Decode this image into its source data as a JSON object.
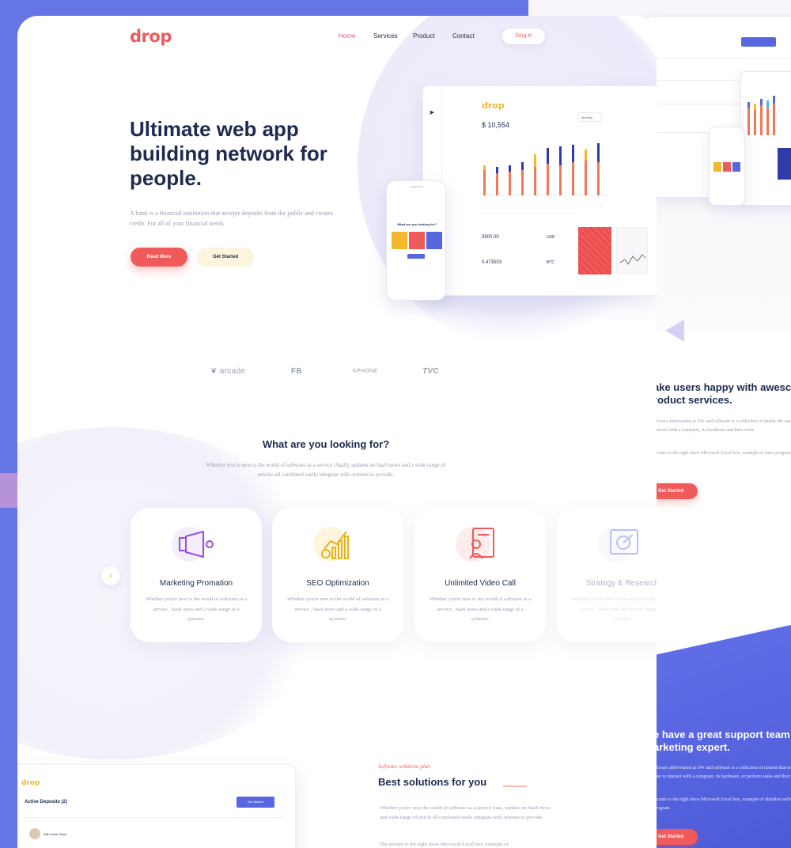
{
  "brand": "drop",
  "nav": {
    "home": "Home",
    "services": "Services",
    "product": "Product",
    "contact": "Contact",
    "signin": "Sing in"
  },
  "hero": {
    "title": "Ultimate web app building network for people.",
    "text": "A bank is a financial institution that accepts deposits from the public and creates credit. For all of your financial needs",
    "read_more": "Read More",
    "get_started": "Get Started"
  },
  "mockup": {
    "logo": "drop",
    "balance": "$ 10,554",
    "selector": "Monthly",
    "amount1": "3500.00",
    "currency1": "USD",
    "amount2": "0.473503",
    "currency2": "BTC",
    "phone_question": "What are you looking for?"
  },
  "partners": [
    "arcade",
    "FB",
    "KPHONE",
    "TVC"
  ],
  "section": {
    "title": "What are you looking for?",
    "text": "Whether you're new to the world of software as a service (SaaS), updates on SaaS news and a wide range of articles all combined easily integrate with systems to provide."
  },
  "cards": [
    {
      "title": "Marketing Promation",
      "text": "Whether you're new to the world of software as a service , SaaS news and a wide-range of a systems.",
      "icon": "megaphone-icon",
      "color": "#9b4ee0"
    },
    {
      "title": "SEO Optimization",
      "text": "Whether you're new to the world of software as a service , SaaS news and a wide-range of a systems.",
      "icon": "seo-chart-icon",
      "color": "#e8b21c"
    },
    {
      "title": "Unlimited Video Call",
      "text": "Whether you're new to the world of software as a service , SaaS news and a wide-range of a systems.",
      "icon": "video-call-icon",
      "color": "#f05a5a"
    },
    {
      "title": "Strategy & Research",
      "text": "Whether you're new to the world of software as a service , SaaS news and a wide-range of a systems.",
      "icon": "strategy-icon",
      "color": "#5867e0"
    }
  ],
  "best": {
    "tagline": "Software solutions plan",
    "title": "Best solutions for you",
    "text": "Whether you're new the world of software as a service Saas, updates on SaaS news and wide-range of article all combined easily integrate with systems to provide.",
    "text2": "The picture to the right show Microsoft Excel box, example of"
  },
  "dashboard": {
    "logo": "drop",
    "title": "Active Deposits (2)",
    "button": "Get Started",
    "row_name": "Will Clarie Stone"
  },
  "page2": {
    "heading1": "ake users happy with awesc\nroduct services.",
    "text1": "oftware abbreviated as SW and software is a collection of enable the user to interact with a computer, its hardware and their work.",
    "text1b": "picture to the right show Microsoft Excel box, example of sines program.",
    "button1": "Get Started",
    "heading2": "e have a great support team\narketing expert.",
    "text2": "oftware abbreviated as SW and software is a collection of uctions that enable the user to interact with a computer, its hardware, or perform tasks and their work.",
    "text2b": "picture to the right show Microsoft Excel box, example of ubsidiest software program.",
    "button2": "Get Started"
  }
}
